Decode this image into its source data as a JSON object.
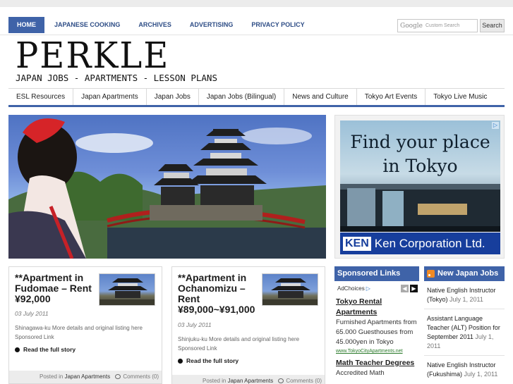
{
  "topnav": {
    "items": [
      "HOME",
      "JAPANESE COOKING",
      "ARCHIVES",
      "ADVERTISING",
      "PRIVACY POLICY"
    ],
    "active": "HOME"
  },
  "search": {
    "google_logo": "Google",
    "placeholder": "Custom Search",
    "button": "Search"
  },
  "logo": {
    "title": "PERKLE",
    "tagline": "JAPAN JOBS - APARTMENTS - LESSON PLANS"
  },
  "catnav": [
    "ESL Resources",
    "Japan Apartments",
    "Japan Jobs",
    "Japan Jobs (Bilingual)",
    "News and Culture",
    "Tokyo Art Events",
    "Tokyo Live Music"
  ],
  "ad": {
    "headline_line1": "Find your place",
    "headline_line2": "in Tokyo",
    "brand_short": "KEN",
    "brand_full": "Ken Corporation Ltd."
  },
  "posts": [
    {
      "title": "**Apartment in Fudomae – Rent ¥92,000",
      "date": "03 July 2011",
      "excerpt": "Shinagawa-ku More details and original listing here Sponsored Link",
      "more": "Read the full story",
      "posted_in_label": "Posted in",
      "category": "Japan Apartments",
      "comments": "Comments (0)"
    },
    {
      "title": "**Apartment in Ochanomizu – Rent ¥89,000~¥91,000",
      "date": "03 July 2011",
      "excerpt": "Shinjuku-ku More details and original listing here Sponsored Link",
      "more": "Read the full story",
      "posted_in_label": "Posted in",
      "category": "Japan Apartments",
      "comments": "Comments (0)"
    }
  ],
  "sponsored": {
    "heading": "Sponsored Links",
    "adchoices": "AdChoices",
    "ads": [
      {
        "title": "Tokyo Rental Apartments",
        "desc": "Furnished Apartments from 65.000 Guesthouses from 45.000yen in Tokyo",
        "url": "www.TokyoCityApartments.net"
      },
      {
        "title": "Math Teacher Degrees",
        "desc": "Accredited Math",
        "url": ""
      }
    ]
  },
  "jobs": {
    "heading": "New Japan Jobs",
    "items": [
      {
        "title": "Native English Instructor (Tokyo)",
        "date": "July 1, 2011"
      },
      {
        "title": "Assistant Language Teacher (ALT) Position for September 2011",
        "date": "July 1, 2011"
      },
      {
        "title": "Native English Instructor (Fukushima)",
        "date": "July 1, 2011"
      }
    ]
  },
  "colors": {
    "accent": "#3f63a8",
    "nav_text": "#2e4d86",
    "rss": "#f08a24"
  }
}
